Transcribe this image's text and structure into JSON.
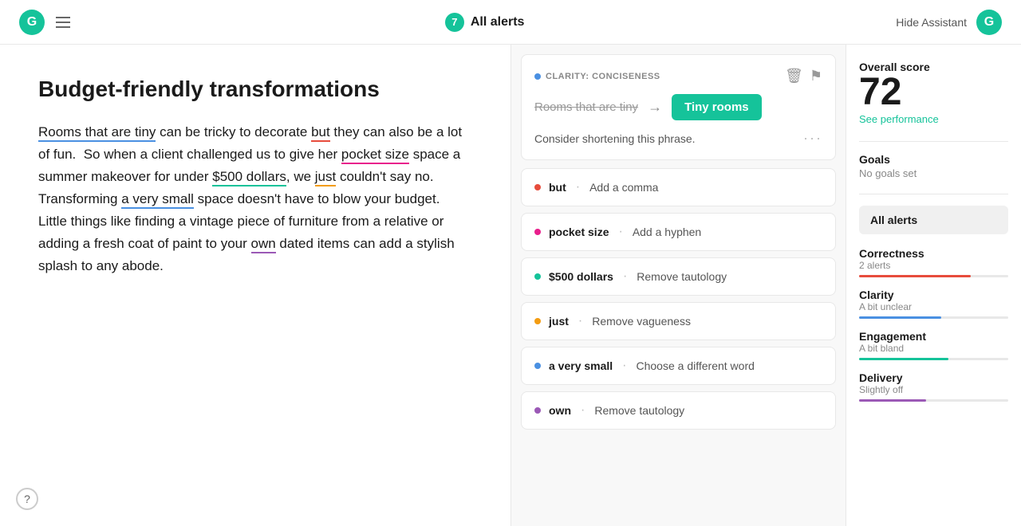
{
  "topbar": {
    "logo_text": "G",
    "alert_count": "7",
    "title": "All alerts",
    "hide_assistant_label": "Hide Assistant"
  },
  "editor": {
    "title": "Budget-friendly transformations",
    "body": "Rooms that are tiny can be tricky to decorate but they can also be a lot of fun. So when a client challenged us to give her pocket size space a summer makeover for under $500 dollars, we just couldn't say no. Transforming a very small space doesn't have to blow your budget. Little things like finding a vintage piece of furniture from a relative or adding a fresh coat of paint to your own dated items can add a stylish splash to any abode."
  },
  "main_card": {
    "tag": "CLARITY: CONCISENESS",
    "original": "Rooms that are tiny",
    "arrow": "→",
    "replacement": "Tiny rooms",
    "description": "Consider shortening this phrase."
  },
  "alerts": [
    {
      "dot": "red",
      "word": "but",
      "sep": "·",
      "message": "Add a comma"
    },
    {
      "dot": "pink",
      "word": "pocket size",
      "sep": "·",
      "message": "Add a hyphen"
    },
    {
      "dot": "teal",
      "word": "$500 dollars",
      "sep": "·",
      "message": "Remove tautology"
    },
    {
      "dot": "orange",
      "word": "just",
      "sep": "·",
      "message": "Remove vagueness"
    },
    {
      "dot": "blue",
      "word": "a very small",
      "sep": "·",
      "message": "Choose a different word"
    },
    {
      "dot": "purple",
      "word": "own",
      "sep": "·",
      "message": "Remove tautology"
    }
  ],
  "sidebar": {
    "score_label": "Overall score",
    "score": "72",
    "score_sub": "See performance",
    "goals_label": "Goals",
    "goals_sub": "No goals set",
    "all_alerts_label": "All alerts",
    "metrics": [
      {
        "name": "Correctness",
        "desc": "2 alerts",
        "bar_class": "bar-red"
      },
      {
        "name": "Clarity",
        "desc": "A bit unclear",
        "bar_class": "bar-blue"
      },
      {
        "name": "Engagement",
        "desc": "A bit bland",
        "bar_class": "bar-green"
      },
      {
        "name": "Delivery",
        "desc": "Slightly off",
        "bar_class": "bar-purple"
      }
    ]
  },
  "icons": {
    "menu": "☰",
    "trash": "🗑",
    "flag": "⚑",
    "dots": "···",
    "help": "?"
  }
}
